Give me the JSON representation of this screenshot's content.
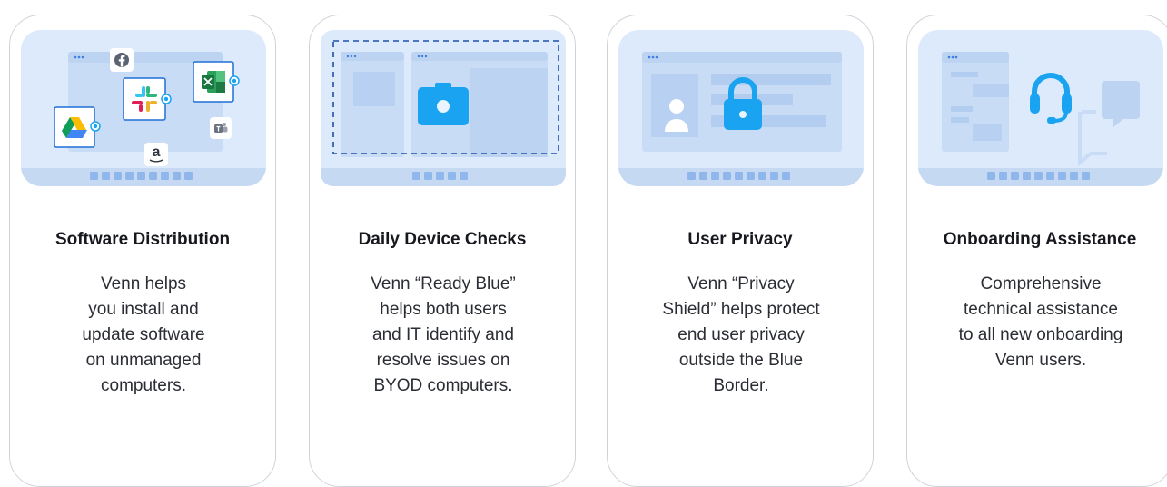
{
  "cards": [
    {
      "title": "Software Distribution",
      "lines": [
        "Venn helps",
        "you install and",
        "update software",
        "on unmanaged",
        "computers."
      ],
      "icons": [
        "facebook-icon",
        "slack-icon",
        "excel-icon",
        "google-drive-icon",
        "teams-icon",
        "amazon-icon"
      ],
      "amazon_glyph": "a"
    },
    {
      "title": "Daily Device Checks",
      "lines": [
        "Venn “Ready Blue”",
        "helps both users",
        "and IT identify and",
        "resolve issues on",
        "BYOD computers."
      ],
      "icons": [
        "camera-icon"
      ]
    },
    {
      "title": "User Privacy",
      "lines": [
        "Venn “Privacy",
        "Shield” helps protect",
        "end user privacy",
        "outside the Blue",
        "Border."
      ],
      "icons": [
        "user-icon",
        "lock-icon"
      ]
    },
    {
      "title": "Onboarding Assistance",
      "lines": [
        "Comprehensive",
        "technical assistance",
        "to all new onboarding",
        "Venn users."
      ],
      "icons": [
        "headset-icon",
        "chat-bubble-icon"
      ]
    }
  ],
  "colors": {
    "accent": "#1aa3f0",
    "illustration_bg": "#ddeafb",
    "panel": "#c9dcf6",
    "border": "#cfd3d9"
  }
}
